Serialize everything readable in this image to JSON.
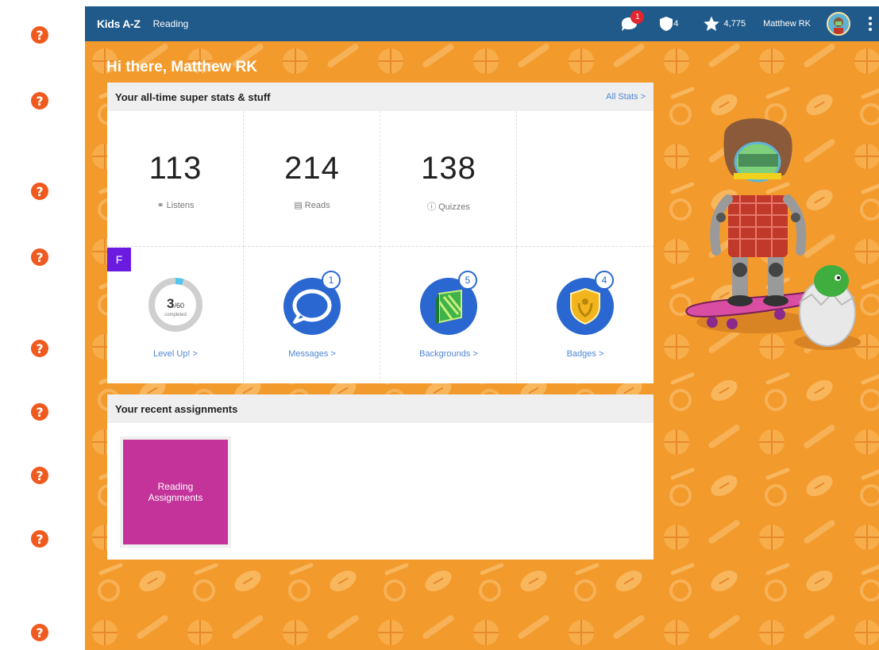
{
  "help_icons": [
    "?",
    "?",
    "?",
    "?",
    "?",
    "?",
    "?",
    "?",
    "?"
  ],
  "topbar": {
    "logo": "Kids A-Z",
    "section": "Reading",
    "message_badge": "1",
    "shield_count": "4",
    "star_count": "4,775",
    "user_name": "Matthew RK",
    "bar_color": "#1f5a8a"
  },
  "greeting": "Hi there, Matthew RK",
  "stats": {
    "title": "Your all-time super stats & stuff",
    "all_stats_link": "All Stats >",
    "listens": {
      "value": "113",
      "label": "Listens"
    },
    "reads": {
      "value": "214",
      "label": "Reads"
    },
    "quizzes": {
      "value": "138",
      "label": "Quizzes"
    },
    "level": {
      "tag": "F",
      "completed": "3",
      "total": "/60",
      "completed_label": "completed",
      "progress_fraction": 0.05,
      "link": "Level Up! >"
    },
    "messages": {
      "count": "1",
      "link": "Messages >"
    },
    "backgrounds": {
      "count": "5",
      "link": "Backgrounds >"
    },
    "badges": {
      "count": "4",
      "link": "Badges >"
    }
  },
  "assignments": {
    "title": "Your recent assignments",
    "tile_label": "Reading Assignments",
    "tile_color": "#c3339a"
  },
  "colors": {
    "background_orange": "#f39a2c",
    "accent_blue": "#2a67d1",
    "link_blue": "#4f86d4",
    "level_purple": "#6a1be0",
    "help_orange": "#f05a1e"
  },
  "icons": [
    "help-icon",
    "message-icon",
    "shield-icon",
    "star-icon",
    "kebab-menu-icon",
    "headphones-icon",
    "book-icon",
    "quiz-icon",
    "speech-bubble-icon",
    "backgrounds-icon",
    "badge-icon"
  ]
}
